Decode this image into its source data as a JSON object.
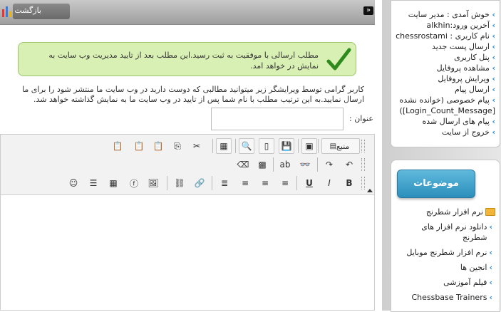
{
  "topbar": {
    "back_label": "بازگشت"
  },
  "success": {
    "message": "مطلب ارسالی با موفقیت به ثبت رسید.این مطلب بعد از تایید مدیریت وب سایت به نمایش در خواهد امد."
  },
  "form": {
    "intro": "کاربر گرامی توسط ویرایشگر زیر میتوانید مطالبی که دوست دارید در وب سایت ما منتشر شود را برای ما ارسال نمایید.به این ترتیب مطلب با نام شما پس از تایید در وب سایت ما به نمایش گذاشته خواهد شد.",
    "title_label": "عنوان :",
    "title_value": ""
  },
  "editor": {
    "source_label": "منبع",
    "bold": "B",
    "italic": "I",
    "underline": "U"
  },
  "sidebar": {
    "user_links": [
      "خوش آمدی : مدیر سایت",
      "آخرین ورود:alkhin",
      "نام کاربری : chessrostami",
      "ارسال پست جدید",
      "پنل کاربری",
      "مشاهده پروفایل",
      "ویرایش پروفایل",
      "ارسال پیام",
      "پیام خصوصی (خوانده نشده [Login_Count_Message])",
      "پیام های ارسال شده",
      "خروج از سایت"
    ],
    "categories_title": "موضوعات",
    "categories_root": "نرم افزار شطرنج",
    "categories": [
      "دانلود نرم افزار های شطرنج",
      "نرم افزار شطرنج موبایل",
      "انجین ها",
      "فیلم آموزشی",
      "Chessbase Trainers"
    ]
  },
  "colors": {
    "success_bg": "#d9f0b4",
    "success_border": "#9bc66a",
    "category_header": "#2c8fbb",
    "link_bullet": "#2a8ad0"
  }
}
